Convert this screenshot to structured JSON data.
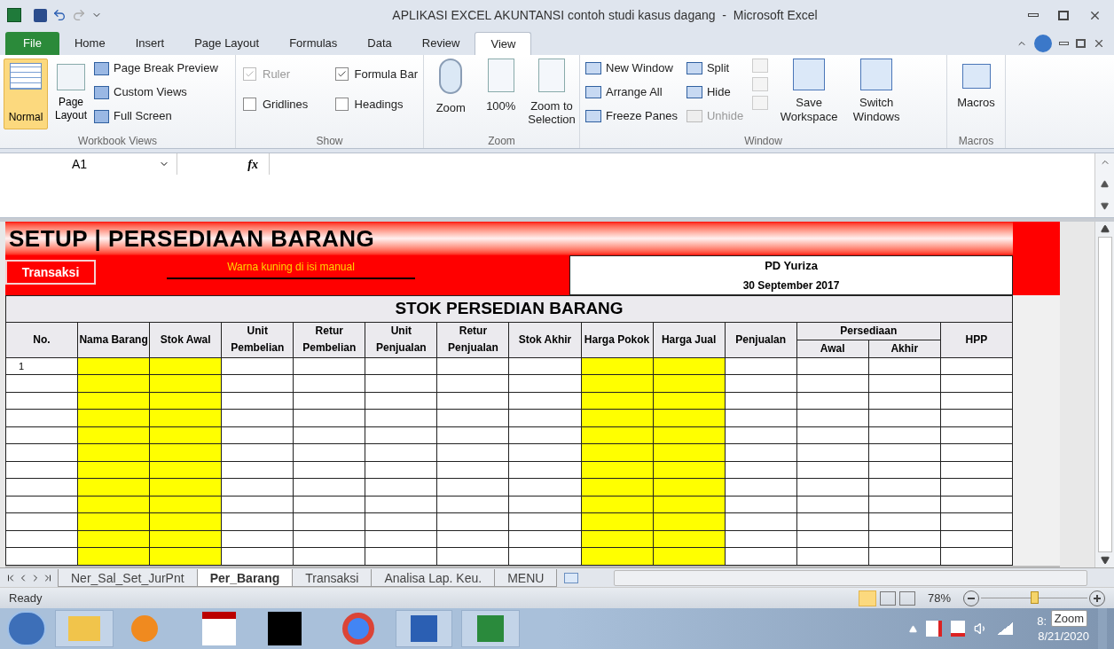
{
  "window": {
    "title": "APLIKASI EXCEL AKUNTANSI contoh studi kasus dagang  -  Microsoft Excel"
  },
  "ribbon_tabs": [
    {
      "label": "File",
      "selected": false,
      "kind": "file"
    },
    {
      "label": "Home",
      "selected": false,
      "kind": "tab"
    },
    {
      "label": "Insert",
      "selected": false,
      "kind": "tab"
    },
    {
      "label": "Page Layout",
      "selected": false,
      "kind": "tab"
    },
    {
      "label": "Formulas",
      "selected": false,
      "kind": "tab"
    },
    {
      "label": "Data",
      "selected": false,
      "kind": "tab"
    },
    {
      "label": "Review",
      "selected": false,
      "kind": "tab"
    },
    {
      "label": "View",
      "selected": true,
      "kind": "tab"
    }
  ],
  "workbook_views": {
    "label": "Workbook Views",
    "normal": {
      "label": "Normal",
      "selected": true
    },
    "page_layout": {
      "label": "Page Layout",
      "selected": false
    },
    "small": [
      "Page Break Preview",
      "Custom Views",
      "Full Screen"
    ]
  },
  "show": {
    "label": "Show",
    "items": [
      {
        "label": "Ruler",
        "checked": true,
        "disabled": true
      },
      {
        "label": "Formula Bar",
        "checked": true,
        "disabled": false
      },
      {
        "label": "Gridlines",
        "checked": false,
        "disabled": false
      },
      {
        "label": "Headings",
        "checked": false,
        "disabled": false
      }
    ]
  },
  "zoom_group": {
    "label": "Zoom",
    "buttons": [
      "Zoom",
      "100%",
      "Zoom to Selection"
    ]
  },
  "window_group": {
    "label": "Window",
    "items": [
      {
        "label": "New Window",
        "disabled": false
      },
      {
        "label": "Arrange All",
        "disabled": false
      },
      {
        "label": "Freeze Panes",
        "disabled": false
      },
      {
        "label": "Split",
        "disabled": false
      },
      {
        "label": "Hide",
        "disabled": false
      },
      {
        "label": "Unhide",
        "disabled": true
      }
    ],
    "large": [
      "Save Workspace",
      "Switch Windows"
    ]
  },
  "macros_group": {
    "label": "Macros",
    "button": "Macros"
  },
  "formula_bar": {
    "name_box": "A1",
    "fx": "fx"
  },
  "sheet": {
    "title": "SETUP | PERSEDIAAN BARANG",
    "button": "Transaksi",
    "note": "Warna kuning di isi manual",
    "company": "PD Yuriza",
    "date": "30 September 2017",
    "table_title": "STOK PERSEDIAN BARANG",
    "columns": [
      {
        "label": "No.",
        "manual": false
      },
      {
        "label": "Nama Barang",
        "manual": true
      },
      {
        "label": "Stok Awal",
        "manual": true
      },
      {
        "label": "Unit Pembelian",
        "manual": false
      },
      {
        "label": "Retur Pembelian",
        "manual": false
      },
      {
        "label": "Unit Penjualan",
        "manual": false
      },
      {
        "label": "Retur Penjualan",
        "manual": false
      },
      {
        "label": "Stok Akhir",
        "manual": false
      },
      {
        "label": "Harga Pokok",
        "manual": true
      },
      {
        "label": "Harga Jual",
        "manual": true
      },
      {
        "label": "Penjualan",
        "manual": false
      },
      {
        "label": "Persediaan",
        "children": [
          {
            "label": "Awal",
            "manual": false
          },
          {
            "label": "Akhir",
            "manual": false
          }
        ]
      },
      {
        "label": "HPP",
        "manual": false
      }
    ],
    "rows": [
      {
        "no": "1"
      },
      {},
      {},
      {},
      {},
      {},
      {},
      {},
      {},
      {},
      {},
      {}
    ]
  },
  "sheet_tabs": [
    {
      "label": "Ner_Sal_Set_JurPnt",
      "selected": false
    },
    {
      "label": "Per_Barang",
      "selected": true
    },
    {
      "label": "Transaksi",
      "selected": false
    },
    {
      "label": "Analisa Lap. Keu.",
      "selected": false
    },
    {
      "label": "MENU",
      "selected": false
    }
  ],
  "status_bar": {
    "status": "Ready",
    "zoom": "78%",
    "level": 0.5
  },
  "taskbar": {
    "clock_time": "8:",
    "clock_date": "8/21/2020",
    "tooltip": "Zoom"
  }
}
